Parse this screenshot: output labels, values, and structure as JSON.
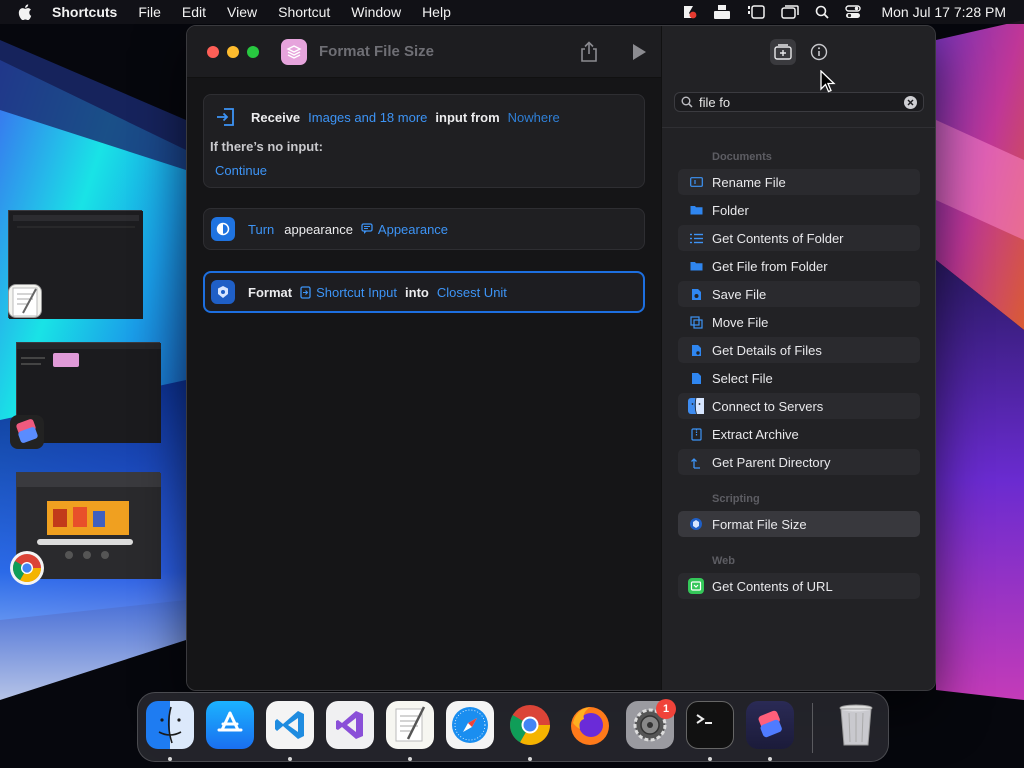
{
  "menubar": {
    "app_name": "Shortcuts",
    "items": [
      "File",
      "Edit",
      "View",
      "Shortcut",
      "Window",
      "Help"
    ],
    "clock": "Mon Jul 17  7:28 PM"
  },
  "window": {
    "title": "Format File Size",
    "accent": "#3d94f6"
  },
  "actions": {
    "receive": {
      "verb": "Receive",
      "types": "Images and 18 more",
      "connector": "input from",
      "source": "Nowhere",
      "no_input_label": "If there’s no input:",
      "no_input_value": "Continue"
    },
    "turn": {
      "verb": "Turn",
      "object": "appearance",
      "value": "Appearance"
    },
    "format": {
      "verb": "Format",
      "input": "Shortcut Input",
      "connector": "into",
      "unit": "Closest Unit"
    }
  },
  "library": {
    "search_value": "file fo",
    "sections": [
      {
        "title": "Documents",
        "items": [
          "Rename File",
          "Folder",
          "Get Contents of Folder",
          "Get File from Folder",
          "Save File",
          "Move File",
          "Get Details of Files",
          "Select File",
          "Connect to Servers",
          "Extract Archive",
          "Get Parent Directory"
        ]
      },
      {
        "title": "Scripting",
        "items": [
          "Format File Size"
        ]
      },
      {
        "title": "Web",
        "items": [
          "Get Contents of URL"
        ]
      }
    ]
  },
  "dock": {
    "apps": [
      "Finder",
      "App Store",
      "Visual Studio Code",
      "Visual Studio",
      "TextEdit",
      "Safari",
      "Google Chrome",
      "Firefox",
      "System Settings",
      "Terminal",
      "Shortcuts",
      "Trash"
    ],
    "settings_badge": "1"
  }
}
